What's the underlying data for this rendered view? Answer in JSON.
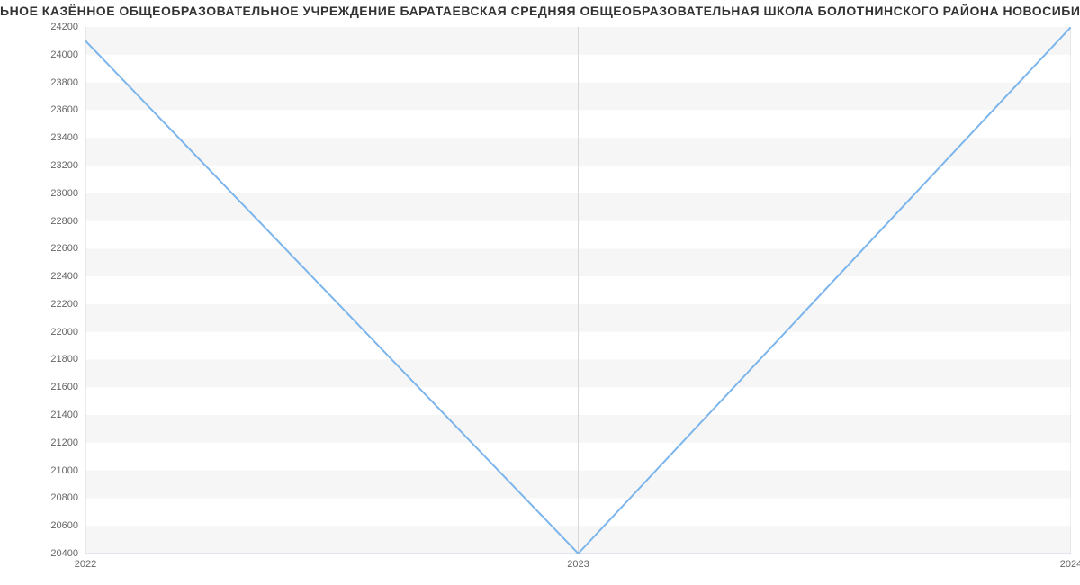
{
  "chart_data": {
    "type": "line",
    "title": "ЬНОЕ КАЗЁННОЕ ОБЩЕОБРАЗОВАТЕЛЬНОЕ УЧРЕЖДЕНИЕ БАРАТАЕВСКАЯ СРЕДНЯЯ ОБЩЕОБРАЗОВАТЕЛЬНАЯ ШКОЛА БОЛОТНИНСКОГО РАЙОНА НОВОСИБИРСКОЙ ОБЛА",
    "categories": [
      "2022",
      "2023",
      "2024"
    ],
    "values": [
      24100,
      20400,
      24200
    ],
    "y_ticks": [
      20400,
      20600,
      20800,
      21000,
      21200,
      21400,
      21600,
      21800,
      22000,
      22200,
      22400,
      22600,
      22800,
      23000,
      23200,
      23400,
      23600,
      23800,
      24000,
      24200
    ],
    "ylim": [
      20400,
      24200
    ],
    "xlabel": "",
    "ylabel": ""
  }
}
